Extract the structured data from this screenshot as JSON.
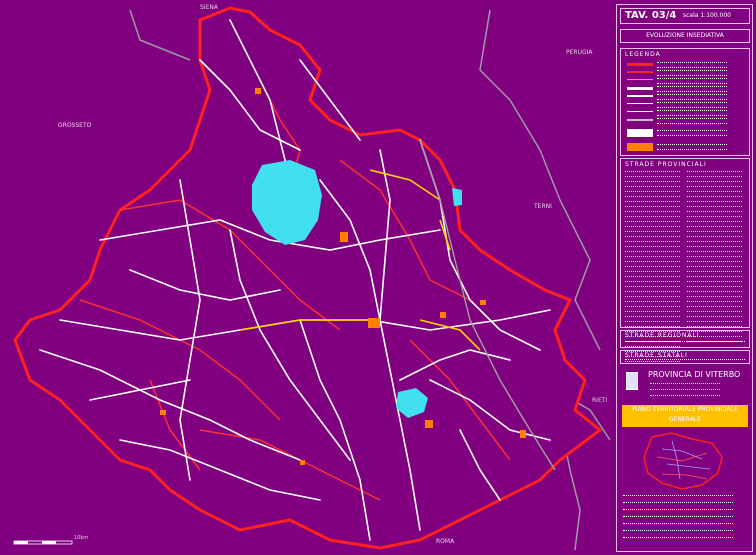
{
  "map": {
    "places": {
      "siena": "SIENA",
      "perugia": "PERUGIA",
      "grosseto": "GROSSETO",
      "terni": "TERNI",
      "rieti": "RIETI",
      "roma": "ROMA"
    },
    "scalebar_label": "10km"
  },
  "panel": {
    "tav": "TAV. 03/4",
    "scale": "scala 1:100.000",
    "subtitle": "EVOLUZIONE INSEDIATIVA",
    "legend_title": "LEGENDA",
    "section_provinciali": "STRADE PROVINCIALI",
    "section_regionali": "STRADE REGIONALI",
    "section_statali": "STRADE STATALI",
    "province": "PROVINCIA DI VITERBO",
    "plan": "PIANO TERRITORIALE PROVINCIALE GENERALE"
  },
  "colors": {
    "background": "#800080",
    "road_primary": "#ff2020",
    "road_secondary": "#ffffff",
    "settlement": "#ff8000",
    "lake": "#40e0f0",
    "highlight": "#ffd000"
  },
  "icons": [
    "scale-bar-icon",
    "north-arrow-icon"
  ]
}
